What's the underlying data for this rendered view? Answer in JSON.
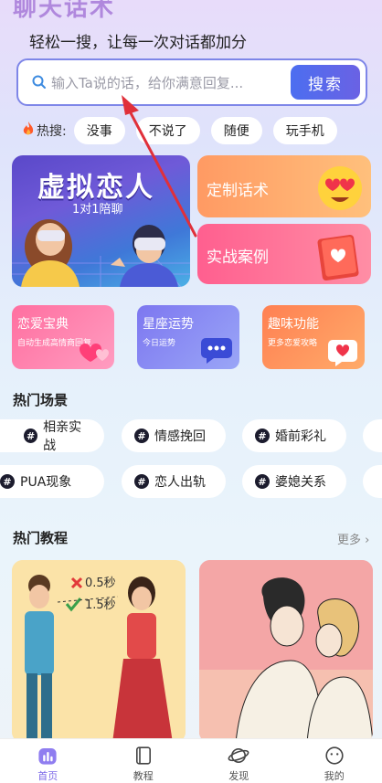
{
  "header": {
    "app_title": "聊天话术",
    "slogan": "轻松一搜，让每一次对话都加分"
  },
  "search": {
    "placeholder": "输入Ta说的话，给你满意回复...",
    "button_label": "搜索"
  },
  "hot_search": {
    "label": "热搜:",
    "tags": [
      "没事",
      "不说了",
      "随便",
      "玩手机"
    ]
  },
  "banner": {
    "title": "虚拟恋人",
    "subtitle": "1对1陪聊"
  },
  "cards": {
    "custom": "定制话术",
    "case": "实战案例"
  },
  "features": [
    {
      "title": "恋爱宝典",
      "subtitle": "自动生成高情商回复"
    },
    {
      "title": "星座运势",
      "subtitle": "今日运势"
    },
    {
      "title": "趣味功能",
      "subtitle": "更多恋爱攻略"
    }
  ],
  "scenes": {
    "title": "热门场景",
    "items": [
      "相亲实战",
      "情感挽回",
      "婚前彩礼",
      "PUA现象",
      "恋人出轨",
      "婆媳关系"
    ]
  },
  "tutorials": {
    "title": "热门教程",
    "more": "更多",
    "card1_times": [
      "0.5秒",
      "1.5秒"
    ]
  },
  "tabbar": {
    "items": [
      "首页",
      "教程",
      "发现",
      "我的"
    ]
  },
  "colors": {
    "accent": "#6a62e4",
    "search_border": "#7e86e8",
    "annotation_arrow": "#e0303a"
  }
}
